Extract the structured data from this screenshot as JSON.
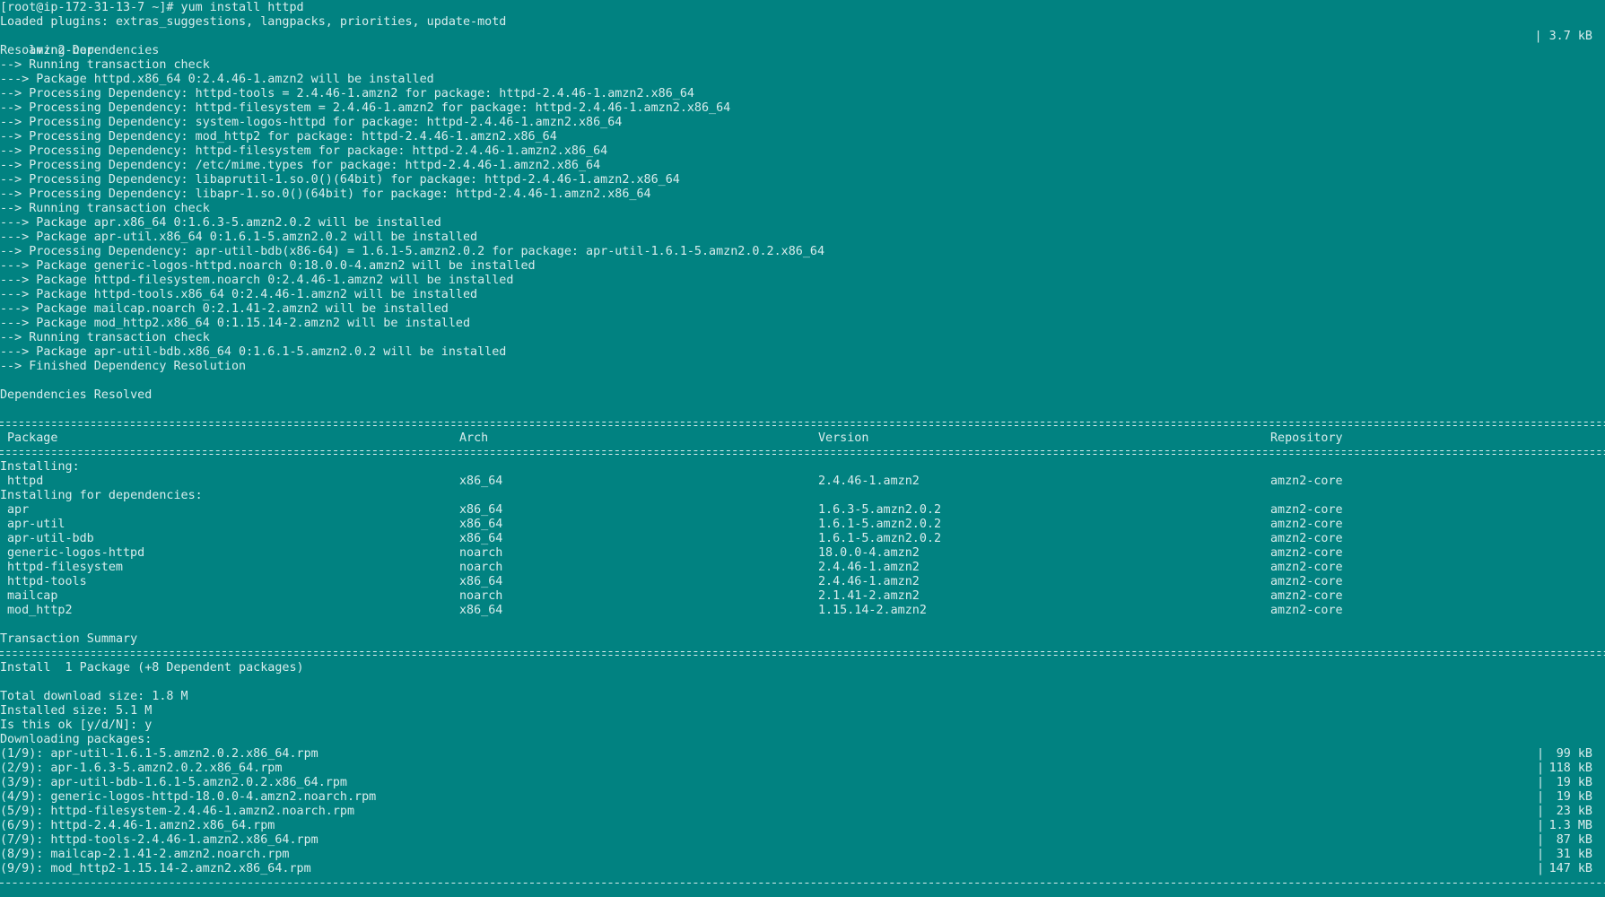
{
  "terminal": {
    "prompt_line": "[root@ip-172-31-13-7 ~]# yum install httpd",
    "plugins_line": "Loaded plugins: extras_suggestions, langpacks, priorities, update-motd",
    "repo_line": {
      "name": "amzn2-core",
      "size": "| 3.7 kB"
    },
    "resolving": [
      "Resolving Dependencies",
      "--> Running transaction check",
      "---> Package httpd.x86_64 0:2.4.46-1.amzn2 will be installed",
      "--> Processing Dependency: httpd-tools = 2.4.46-1.amzn2 for package: httpd-2.4.46-1.amzn2.x86_64",
      "--> Processing Dependency: httpd-filesystem = 2.4.46-1.amzn2 for package: httpd-2.4.46-1.amzn2.x86_64",
      "--> Processing Dependency: system-logos-httpd for package: httpd-2.4.46-1.amzn2.x86_64",
      "--> Processing Dependency: mod_http2 for package: httpd-2.4.46-1.amzn2.x86_64",
      "--> Processing Dependency: httpd-filesystem for package: httpd-2.4.46-1.amzn2.x86_64",
      "--> Processing Dependency: /etc/mime.types for package: httpd-2.4.46-1.amzn2.x86_64",
      "--> Processing Dependency: libaprutil-1.so.0()(64bit) for package: httpd-2.4.46-1.amzn2.x86_64",
      "--> Processing Dependency: libapr-1.so.0()(64bit) for package: httpd-2.4.46-1.amzn2.x86_64",
      "--> Running transaction check",
      "---> Package apr.x86_64 0:1.6.3-5.amzn2.0.2 will be installed",
      "---> Package apr-util.x86_64 0:1.6.1-5.amzn2.0.2 will be installed",
      "--> Processing Dependency: apr-util-bdb(x86-64) = 1.6.1-5.amzn2.0.2 for package: apr-util-1.6.1-5.amzn2.0.2.x86_64",
      "---> Package generic-logos-httpd.noarch 0:18.0.0-4.amzn2 will be installed",
      "---> Package httpd-filesystem.noarch 0:2.4.46-1.amzn2 will be installed",
      "---> Package httpd-tools.x86_64 0:2.4.46-1.amzn2 will be installed",
      "---> Package mailcap.noarch 0:2.1.41-2.amzn2 will be installed",
      "---> Package mod_http2.x86_64 0:1.15.14-2.amzn2 will be installed",
      "--> Running transaction check",
      "---> Package apr-util-bdb.x86_64 0:1.6.1-5.amzn2.0.2 will be installed",
      "--> Finished Dependency Resolution"
    ],
    "deps_resolved": "Dependencies Resolved",
    "table": {
      "headers": {
        "package": "Package",
        "arch": "Arch",
        "version": "Version",
        "repository": "Repository"
      },
      "installing_label": "Installing:",
      "installing": [
        {
          "package": "httpd",
          "arch": "x86_64",
          "version": "2.4.46-1.amzn2",
          "repository": "amzn2-core"
        }
      ],
      "deps_label": "Installing for dependencies:",
      "dependencies": [
        {
          "package": "apr",
          "arch": "x86_64",
          "version": "1.6.3-5.amzn2.0.2",
          "repository": "amzn2-core"
        },
        {
          "package": "apr-util",
          "arch": "x86_64",
          "version": "1.6.1-5.amzn2.0.2",
          "repository": "amzn2-core"
        },
        {
          "package": "apr-util-bdb",
          "arch": "x86_64",
          "version": "1.6.1-5.amzn2.0.2",
          "repository": "amzn2-core"
        },
        {
          "package": "generic-logos-httpd",
          "arch": "noarch",
          "version": "18.0.0-4.amzn2",
          "repository": "amzn2-core"
        },
        {
          "package": "httpd-filesystem",
          "arch": "noarch",
          "version": "2.4.46-1.amzn2",
          "repository": "amzn2-core"
        },
        {
          "package": "httpd-tools",
          "arch": "x86_64",
          "version": "2.4.46-1.amzn2",
          "repository": "amzn2-core"
        },
        {
          "package": "mailcap",
          "arch": "noarch",
          "version": "2.1.41-2.amzn2",
          "repository": "amzn2-core"
        },
        {
          "package": "mod_http2",
          "arch": "x86_64",
          "version": "1.15.14-2.amzn2",
          "repository": "amzn2-core"
        }
      ]
    },
    "summary_label": "Transaction Summary",
    "install_line": "Install  1 Package (+8 Dependent packages)",
    "download_size": "Total download size: 1.8 M",
    "installed_size": "Installed size: 5.1 M",
    "confirm_prompt": "Is this ok [y/d/N]: y",
    "downloading_label": "Downloading packages:",
    "downloads": [
      {
        "name": "(1/9): apr-util-1.6.1-5.amzn2.0.2.x86_64.rpm",
        "size": "99 kB"
      },
      {
        "name": "(2/9): apr-1.6.3-5.amzn2.0.2.x86_64.rpm",
        "size": "118 kB"
      },
      {
        "name": "(3/9): apr-util-bdb-1.6.1-5.amzn2.0.2.x86_64.rpm",
        "size": "19 kB"
      },
      {
        "name": "(4/9): generic-logos-httpd-18.0.0-4.amzn2.noarch.rpm",
        "size": "19 kB"
      },
      {
        "name": "(5/9): httpd-filesystem-2.4.46-1.amzn2.noarch.rpm",
        "size": "23 kB"
      },
      {
        "name": "(6/9): httpd-2.4.46-1.amzn2.x86_64.rpm",
        "size": "1.3 MB"
      },
      {
        "name": "(7/9): httpd-tools-2.4.46-1.amzn2.x86_64.rpm",
        "size": "87 kB"
      },
      {
        "name": "(8/9): mailcap-2.1.41-2.amzn2.noarch.rpm",
        "size": "31 kB"
      },
      {
        "name": "(9/9): mod_http2-1.15.14-2.amzn2.x86_64.rpm",
        "size": "147 kB"
      }
    ],
    "pipe_char": "|",
    "colors": {
      "background": "#018281",
      "foreground": "#d8ecec"
    }
  }
}
